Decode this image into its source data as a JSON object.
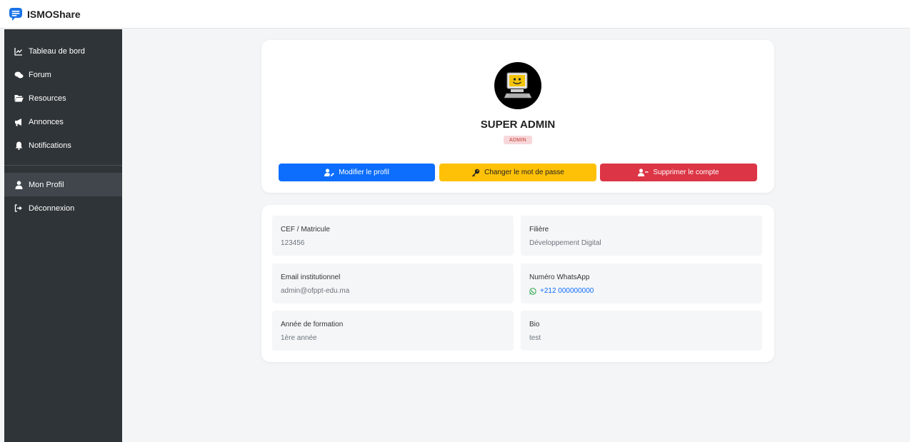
{
  "app": {
    "title": "ISMOShare"
  },
  "sidebar": {
    "items": [
      {
        "label": "Tableau de bord",
        "icon": "chart-line-icon"
      },
      {
        "label": "Forum",
        "icon": "comments-icon"
      },
      {
        "label": "Resources",
        "icon": "folder-open-icon"
      },
      {
        "label": "Annonces",
        "icon": "bullhorn-icon"
      },
      {
        "label": "Notifications",
        "icon": "bell-icon"
      }
    ],
    "bottom_items": [
      {
        "label": "Mon Profil",
        "icon": "user-icon",
        "active": true
      },
      {
        "label": "Déconnexion",
        "icon": "sign-out-icon"
      }
    ]
  },
  "profile": {
    "name": "SUPER ADMIN",
    "role": "ADMIN",
    "buttons": {
      "edit": "Modifier le profil",
      "password": "Changer le mot de passe",
      "delete": "Supprimer le compte"
    }
  },
  "info": {
    "cef": {
      "label": "CEF / Matricule",
      "value": "123456"
    },
    "filiere": {
      "label": "Filière",
      "value": "Développement Digital"
    },
    "email": {
      "label": "Email institutionnel",
      "value": "admin@ofppt-edu.ma"
    },
    "whatsapp": {
      "label": "Numéro WhatsApp",
      "value": "+212 000000000"
    },
    "annee": {
      "label": "Année de formation",
      "value": "1ère année"
    },
    "bio": {
      "label": "Bio",
      "value": "test"
    }
  },
  "colors": {
    "primary": "#0d6efd",
    "warning": "#ffc107",
    "danger": "#dc3545",
    "sidebar": "#2f3438",
    "whatsapp": "#25a244"
  }
}
